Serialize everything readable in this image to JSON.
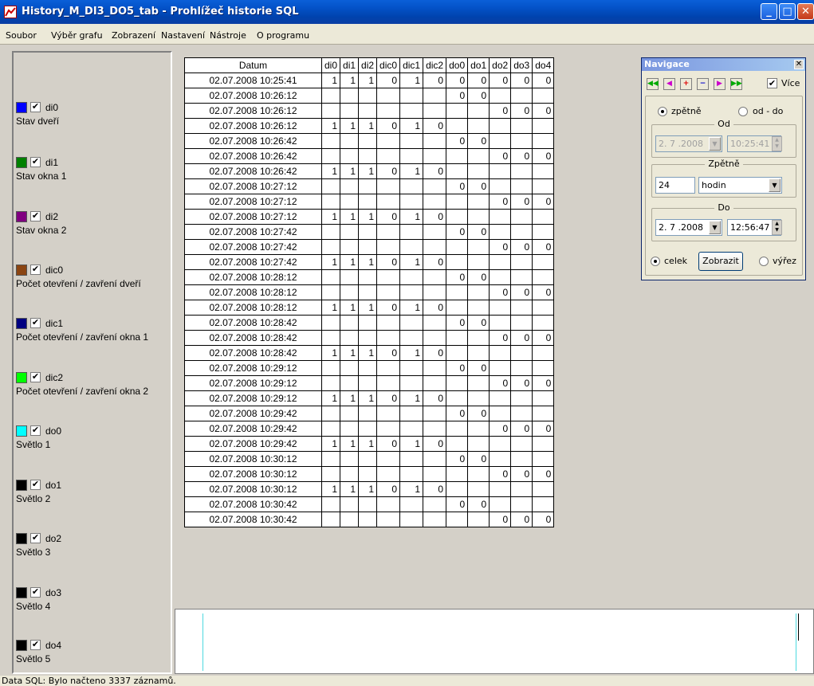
{
  "window": {
    "title": "History_M_DI3_DO5_tab - Prohlížeč historie SQL",
    "min_glyph": "_",
    "max_glyph": "□",
    "close_glyph": "✕"
  },
  "menu": [
    "Soubor",
    "Výběr grafu",
    "Zobrazení",
    "Nastavení",
    "Nástroje",
    "O programu"
  ],
  "legend": [
    {
      "code": "di0",
      "desc": "Stav dveří",
      "color": "#0000ff",
      "checked": "✔"
    },
    {
      "code": "di1",
      "desc": "Stav okna 1",
      "color": "#008000",
      "checked": "✔"
    },
    {
      "code": "di2",
      "desc": "Stav okna 2",
      "color": "#800080",
      "checked": "✔"
    },
    {
      "code": "dic0",
      "desc": "Počet otevření / zavření dveří",
      "color": "#8b4513",
      "checked": "✔"
    },
    {
      "code": "dic1",
      "desc": "Počet otevření / zavření okna 1",
      "color": "#000080",
      "checked": "✔"
    },
    {
      "code": "dic2",
      "desc": "Počet otevření / zavření okna 2",
      "color": "#00ff00",
      "checked": "✔"
    },
    {
      "code": "do0",
      "desc": "Světlo 1",
      "color": "#00ffff",
      "checked": "✔"
    },
    {
      "code": "do1",
      "desc": "Světlo 2",
      "color": "#000000",
      "checked": "✔"
    },
    {
      "code": "do2",
      "desc": "Světlo 3",
      "color": "#000000",
      "checked": "✔"
    },
    {
      "code": "do3",
      "desc": "Světlo 4",
      "color": "#000000",
      "checked": "✔"
    },
    {
      "code": "do4",
      "desc": "Světlo 5",
      "color": "#000000",
      "checked": "✔"
    }
  ],
  "table": {
    "columns": [
      "Datum",
      "di0",
      "di1",
      "di2",
      "dic0",
      "dic1",
      "dic2",
      "do0",
      "do1",
      "do2",
      "do3",
      "do4"
    ],
    "rows": [
      [
        "02.07.2008 10:25:41",
        "1",
        "1",
        "1",
        "0",
        "1",
        "0",
        "0",
        "0",
        "0",
        "0",
        "0"
      ],
      [
        "02.07.2008 10:26:12",
        "",
        "",
        "",
        "",
        "",
        "",
        "0",
        "0",
        "",
        "",
        ""
      ],
      [
        "02.07.2008 10:26:12",
        "",
        "",
        "",
        "",
        "",
        "",
        "",
        "",
        "0",
        "0",
        "0"
      ],
      [
        "02.07.2008 10:26:12",
        "1",
        "1",
        "1",
        "0",
        "1",
        "0",
        "",
        "",
        "",
        "",
        ""
      ],
      [
        "02.07.2008 10:26:42",
        "",
        "",
        "",
        "",
        "",
        "",
        "0",
        "0",
        "",
        "",
        ""
      ],
      [
        "02.07.2008 10:26:42",
        "",
        "",
        "",
        "",
        "",
        "",
        "",
        "",
        "0",
        "0",
        "0"
      ],
      [
        "02.07.2008 10:26:42",
        "1",
        "1",
        "1",
        "0",
        "1",
        "0",
        "",
        "",
        "",
        "",
        ""
      ],
      [
        "02.07.2008 10:27:12",
        "",
        "",
        "",
        "",
        "",
        "",
        "0",
        "0",
        "",
        "",
        ""
      ],
      [
        "02.07.2008 10:27:12",
        "",
        "",
        "",
        "",
        "",
        "",
        "",
        "",
        "0",
        "0",
        "0"
      ],
      [
        "02.07.2008 10:27:12",
        "1",
        "1",
        "1",
        "0",
        "1",
        "0",
        "",
        "",
        "",
        "",
        ""
      ],
      [
        "02.07.2008 10:27:42",
        "",
        "",
        "",
        "",
        "",
        "",
        "0",
        "0",
        "",
        "",
        ""
      ],
      [
        "02.07.2008 10:27:42",
        "",
        "",
        "",
        "",
        "",
        "",
        "",
        "",
        "0",
        "0",
        "0"
      ],
      [
        "02.07.2008 10:27:42",
        "1",
        "1",
        "1",
        "0",
        "1",
        "0",
        "",
        "",
        "",
        "",
        ""
      ],
      [
        "02.07.2008 10:28:12",
        "",
        "",
        "",
        "",
        "",
        "",
        "0",
        "0",
        "",
        "",
        ""
      ],
      [
        "02.07.2008 10:28:12",
        "",
        "",
        "",
        "",
        "",
        "",
        "",
        "",
        "0",
        "0",
        "0"
      ],
      [
        "02.07.2008 10:28:12",
        "1",
        "1",
        "1",
        "0",
        "1",
        "0",
        "",
        "",
        "",
        "",
        ""
      ],
      [
        "02.07.2008 10:28:42",
        "",
        "",
        "",
        "",
        "",
        "",
        "0",
        "0",
        "",
        "",
        ""
      ],
      [
        "02.07.2008 10:28:42",
        "",
        "",
        "",
        "",
        "",
        "",
        "",
        "",
        "0",
        "0",
        "0"
      ],
      [
        "02.07.2008 10:28:42",
        "1",
        "1",
        "1",
        "0",
        "1",
        "0",
        "",
        "",
        "",
        "",
        ""
      ],
      [
        "02.07.2008 10:29:12",
        "",
        "",
        "",
        "",
        "",
        "",
        "0",
        "0",
        "",
        "",
        ""
      ],
      [
        "02.07.2008 10:29:12",
        "",
        "",
        "",
        "",
        "",
        "",
        "",
        "",
        "0",
        "0",
        "0"
      ],
      [
        "02.07.2008 10:29:12",
        "1",
        "1",
        "1",
        "0",
        "1",
        "0",
        "",
        "",
        "",
        "",
        ""
      ],
      [
        "02.07.2008 10:29:42",
        "",
        "",
        "",
        "",
        "",
        "",
        "0",
        "0",
        "",
        "",
        ""
      ],
      [
        "02.07.2008 10:29:42",
        "",
        "",
        "",
        "",
        "",
        "",
        "",
        "",
        "0",
        "0",
        "0"
      ],
      [
        "02.07.2008 10:29:42",
        "1",
        "1",
        "1",
        "0",
        "1",
        "0",
        "",
        "",
        "",
        "",
        ""
      ],
      [
        "02.07.2008 10:30:12",
        "",
        "",
        "",
        "",
        "",
        "",
        "0",
        "0",
        "",
        "",
        ""
      ],
      [
        "02.07.2008 10:30:12",
        "",
        "",
        "",
        "",
        "",
        "",
        "",
        "",
        "0",
        "0",
        "0"
      ],
      [
        "02.07.2008 10:30:12",
        "1",
        "1",
        "1",
        "0",
        "1",
        "0",
        "",
        "",
        "",
        "",
        ""
      ],
      [
        "02.07.2008 10:30:42",
        "",
        "",
        "",
        "",
        "",
        "",
        "0",
        "0",
        "",
        "",
        ""
      ],
      [
        "02.07.2008 10:30:42",
        "",
        "",
        "",
        "",
        "",
        "",
        "",
        "",
        "0",
        "0",
        "0"
      ]
    ]
  },
  "nav": {
    "title": "Navigace",
    "close_glyph": "✕",
    "buttons": [
      {
        "name": "first-button",
        "glyph": "◀◀",
        "color": "green"
      },
      {
        "name": "prev-button",
        "glyph": "◀",
        "color": "magenta"
      },
      {
        "name": "zoom-in-button",
        "glyph": "+",
        "color": "red"
      },
      {
        "name": "zoom-out-button",
        "glyph": "−",
        "color": "blue"
      },
      {
        "name": "next-button",
        "glyph": "▶",
        "color": "magenta"
      },
      {
        "name": "last-button",
        "glyph": "▶▶",
        "color": "green"
      }
    ],
    "vice_label": "Více",
    "vice_checked": "✔",
    "radio_back": "zpětně",
    "radio_range": "od - do",
    "od_title": "Od",
    "od_date": "2. 7 .2008",
    "od_time": "10:25:41",
    "zpetne_title": "Zpětně",
    "zpetne_value": "24",
    "zpetne_unit": "hodin",
    "do_title": "Do",
    "do_date": "2. 7 .2008",
    "do_time": "12:56:47",
    "radio_whole": "celek",
    "show_button": "Zobrazit",
    "radio_cut": "výřez"
  },
  "status": "Data SQL: Bylo načteno 3337 záznamů."
}
